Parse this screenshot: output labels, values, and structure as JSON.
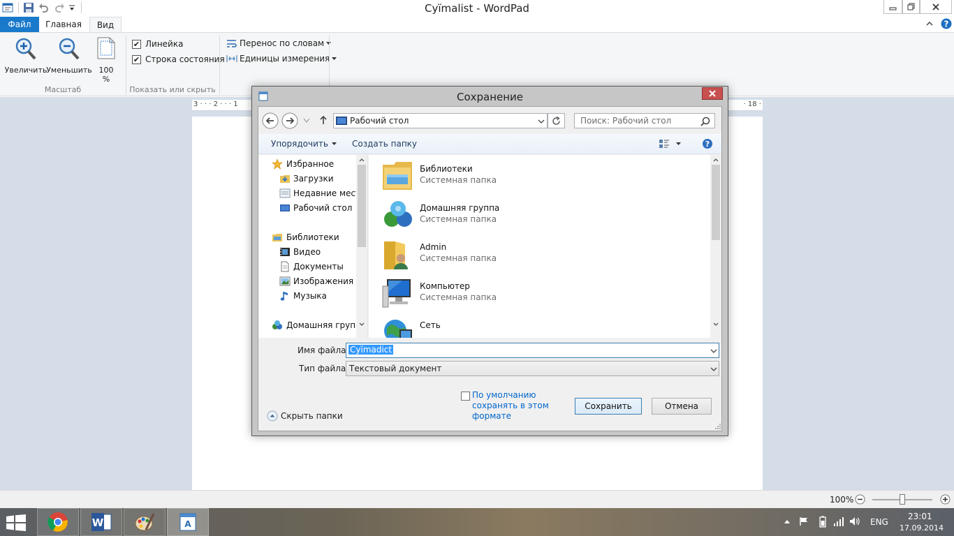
{
  "window": {
    "title": "Cyïmalist - WordPad"
  },
  "ribbon": {
    "tabs": [
      {
        "label": "Файл"
      },
      {
        "label": "Главная"
      },
      {
        "label": "Вид"
      }
    ],
    "zoom_in_label": "Увеличить",
    "zoom_out_label": "Уменьшить",
    "zoom_100_line1": "100",
    "zoom_100_line2": "%",
    "zoom_group_label": "Масштаб",
    "ruler_label": "Линейка",
    "statusbar_label": "Строка состояния",
    "show_group_label": "Показать или скрыть",
    "wordwrap_label": "Перенос по словам",
    "units_label": "Единицы измерения"
  },
  "ruler": {
    "left_marks": "3 · · · 2 · · · 1",
    "right_marks": "· 18 ·"
  },
  "status": {
    "zoom": "100%",
    "zoom_level_percent": 100
  },
  "dialog": {
    "title": "Сохранение",
    "address": "Рабочий стол",
    "search_placeholder": "Поиск: Рабочий стол",
    "organize_label": "Упорядочить",
    "new_folder_label": "Создать папку",
    "nav": {
      "favorites": "Избранное",
      "downloads": "Загрузки",
      "recent": "Недавние места",
      "desktop": "Рабочий стол",
      "libraries": "Библиотеки",
      "video": "Видео",
      "documents": "Документы",
      "images": "Изображения",
      "music": "Музыка",
      "homegroup": "Домашняя группа"
    },
    "items": [
      {
        "name": "Библиотеки",
        "type": "Системная папка",
        "icon": "libraries-icon"
      },
      {
        "name": "Домашняя группа",
        "type": "Системная папка",
        "icon": "homegroup-icon"
      },
      {
        "name": "Admin",
        "type": "Системная папка",
        "icon": "user-folder-icon"
      },
      {
        "name": "Компьютер",
        "type": "Системная папка",
        "icon": "computer-icon"
      },
      {
        "name": "Сеть",
        "type": "",
        "icon": "network-icon"
      }
    ],
    "filename_label": "Имя файла:",
    "filename_value": "Cyïmadict",
    "filetype_label": "Тип файла:",
    "filetype_value": "Текстовый документ",
    "default_save_line1": "По умолчанию",
    "default_save_line2": "сохранять в этом",
    "default_save_line3": "формате",
    "save_label": "Сохранить",
    "cancel_label": "Отмена",
    "hide_folders_label": "Скрыть папки"
  },
  "taskbar": {
    "apps": [
      "chrome-icon",
      "word-icon",
      "paint-icon",
      "wordpad-icon"
    ],
    "language": "ENG",
    "time": "23:01",
    "date": "17.09.2014"
  },
  "colors": {
    "file_tab": "#1979ca",
    "accent": "#3c7fb1",
    "link": "#0066cc"
  }
}
